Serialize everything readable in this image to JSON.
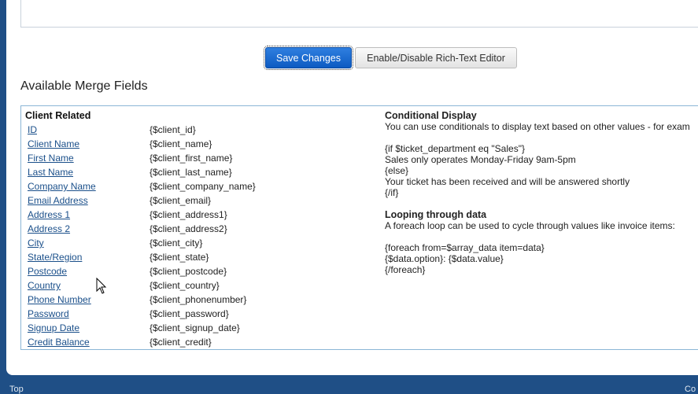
{
  "toolbar": {
    "save_label": "Save Changes",
    "toggle_label": "Enable/Disable Rich-Text Editor"
  },
  "merge_fields": {
    "heading": "Available Merge Fields",
    "client_related": {
      "title": "Client Related",
      "fields": [
        {
          "label": "ID",
          "tag": "{$client_id}"
        },
        {
          "label": "Client Name",
          "tag": "{$client_name}"
        },
        {
          "label": "First Name",
          "tag": "{$client_first_name}"
        },
        {
          "label": "Last Name",
          "tag": "{$client_last_name}"
        },
        {
          "label": "Company Name",
          "tag": "{$client_company_name}"
        },
        {
          "label": "Email Address",
          "tag": "{$client_email}"
        },
        {
          "label": "Address 1",
          "tag": "{$client_address1}"
        },
        {
          "label": "Address 2",
          "tag": "{$client_address2}"
        },
        {
          "label": "City",
          "tag": "{$client_city}"
        },
        {
          "label": "State/Region",
          "tag": "{$client_state}"
        },
        {
          "label": "Postcode",
          "tag": "{$client_postcode}"
        },
        {
          "label": "Country",
          "tag": "{$client_country}"
        },
        {
          "label": "Phone Number",
          "tag": "{$client_phonenumber}"
        },
        {
          "label": "Password",
          "tag": "{$client_password}"
        },
        {
          "label": "Signup Date",
          "tag": "{$client_signup_date}"
        },
        {
          "label": "Credit Balance",
          "tag": "{$client_credit}"
        }
      ]
    },
    "conditional": {
      "title": "Conditional Display",
      "description": "You can use conditionals to display text based on other values - for exam",
      "code": [
        "{if $ticket_department eq \"Sales\"}",
        "Sales only operates Monday-Friday 9am-5pm",
        "{else}",
        "Your ticket has been received and will be answered shortly",
        "{/if}"
      ]
    },
    "looping": {
      "title": "Looping through data",
      "description": "A foreach loop can be used to cycle through values like invoice items:",
      "code": [
        "{foreach from=$array_data item=data}",
        "{$data.option}: {$data.value}",
        "{/foreach}"
      ]
    }
  },
  "footer": {
    "left": "Top",
    "right": "Co"
  },
  "colors": {
    "background": "#1f4f86",
    "link": "#1a4f8a",
    "primary_button": "#0d5bc2",
    "table_border": "#8bb6d6"
  }
}
